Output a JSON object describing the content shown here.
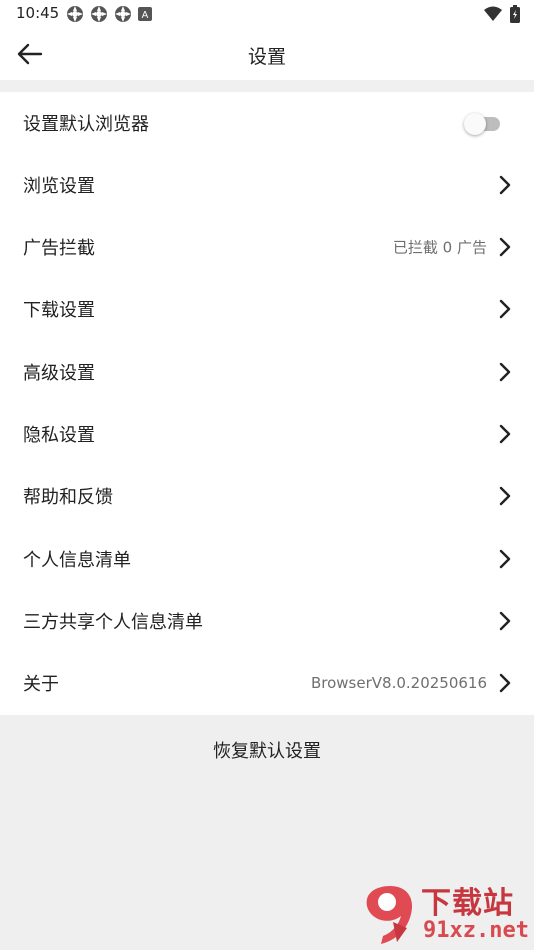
{
  "status_bar": {
    "time": "10:45",
    "left_icons": [
      "notification-icon",
      "notification-icon",
      "notification-icon",
      "keyboard-a-icon"
    ],
    "right_icons": [
      "wifi-icon",
      "battery-icon"
    ],
    "keyboard_letter": "A"
  },
  "app_bar": {
    "title": "设置",
    "back_icon": "back-arrow-icon"
  },
  "settings": {
    "items": [
      {
        "label": "设置默认浏览器",
        "control": "toggle",
        "toggle_on": false
      },
      {
        "label": "浏览设置",
        "control": "chevron"
      },
      {
        "label": "广告拦截",
        "value": "已拦截 0 广告",
        "control": "chevron"
      },
      {
        "label": "下载设置",
        "control": "chevron"
      },
      {
        "label": "高级设置",
        "control": "chevron"
      },
      {
        "label": "隐私设置",
        "control": "chevron"
      },
      {
        "label": "帮助和反馈",
        "control": "chevron"
      },
      {
        "label": "个人信息清单",
        "control": "chevron"
      },
      {
        "label": "三方共享个人信息清单",
        "control": "chevron"
      },
      {
        "label": "关于",
        "value": "BrowserV8.0.20250616",
        "control": "chevron"
      }
    ]
  },
  "restore": {
    "label": "恢复默认设置"
  },
  "watermark": {
    "line1": "下载站",
    "line2": "91xz.net",
    "logo_text": "9"
  },
  "colors": {
    "background": "#efefef",
    "surface": "#ffffff",
    "text_primary": "#222222",
    "text_secondary": "#6f6f6f",
    "toggle_track_off": "#bdbdbd",
    "watermark_red": "#c7373f"
  }
}
